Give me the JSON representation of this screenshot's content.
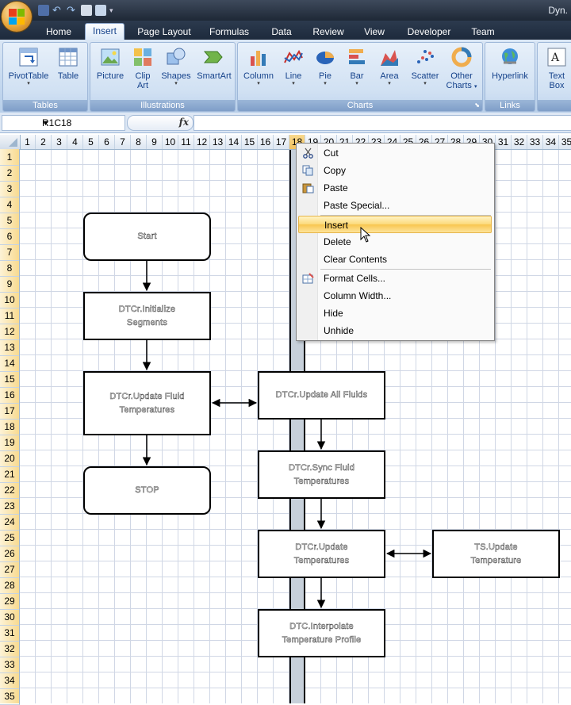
{
  "title_bar": {
    "app_title": "Dyn."
  },
  "tabs": [
    "Home",
    "Insert",
    "Page Layout",
    "Formulas",
    "Data",
    "Review",
    "View",
    "Developer",
    "Team"
  ],
  "active_tab": "Insert",
  "ribbon": {
    "groups": {
      "tables": {
        "label": "Tables",
        "buttons": [
          "PivotTable",
          "Table"
        ]
      },
      "illustrations": {
        "label": "Illustrations",
        "buttons": [
          "Picture",
          "Clip Art",
          "Shapes",
          "SmartArt"
        ]
      },
      "charts": {
        "label": "Charts",
        "buttons": [
          "Column",
          "Line",
          "Pie",
          "Bar",
          "Area",
          "Scatter",
          "Other Charts"
        ]
      },
      "links": {
        "label": "Links",
        "buttons": [
          "Hyperlink"
        ]
      },
      "text": {
        "buttons": [
          "Text Box"
        ]
      }
    },
    "clip_art_l1": "Clip",
    "clip_art_l2": "Art",
    "other_charts_l1": "Other",
    "other_charts_l2": "Charts",
    "text_box_l1": "Text",
    "text_box_l2": "Box"
  },
  "formula_bar": {
    "name_box": "R1C18",
    "fx_label": "fx",
    "formula": ""
  },
  "columns": [
    "1",
    "2",
    "3",
    "4",
    "5",
    "6",
    "7",
    "8",
    "9",
    "10",
    "11",
    "12",
    "13",
    "14",
    "15",
    "16",
    "17",
    "18",
    "19",
    "20",
    "21",
    "22",
    "23",
    "24",
    "25",
    "26",
    "27",
    "28",
    "29",
    "30",
    "31",
    "32",
    "33",
    "34",
    "35"
  ],
  "selected_column": "18",
  "rows": [
    "1",
    "2",
    "3",
    "4",
    "5",
    "6",
    "7",
    "8",
    "9",
    "10",
    "11",
    "12",
    "13",
    "14",
    "15",
    "16",
    "17",
    "18",
    "19",
    "20",
    "21",
    "22",
    "23",
    "24",
    "25",
    "26",
    "27",
    "28",
    "29",
    "30",
    "31",
    "32",
    "33",
    "34",
    "35"
  ],
  "flowchart": {
    "start": "Start",
    "initialize_l1": "DTCr.Initialize",
    "initialize_l2": "Segments",
    "update_fluid_l1": "DTCr.Update Fluid",
    "update_fluid_l2": "Temperatures",
    "stop": "STOP",
    "update_all": "DTCr.Update All Fluids",
    "sync_l1": "DTCr.Sync Fluid",
    "sync_l2": "Temperatures",
    "update_temp_l1": "DTCr.Update",
    "update_temp_l2": "Temperatures",
    "ts_update_l1": "TS.Update",
    "ts_update_l2": "Temperature",
    "profile_l1": "DTC.Interpolate",
    "profile_l2": "Temperature Profile"
  },
  "context_menu": {
    "items": [
      "Cut",
      "Copy",
      "Paste",
      "Paste Special...",
      "Insert",
      "Delete",
      "Clear Contents",
      "Format Cells...",
      "Column Width...",
      "Hide",
      "Unhide"
    ],
    "highlighted": "Insert"
  },
  "colors": {
    "accent": "#15428b",
    "highlight": "#f8c64f",
    "selected_header": "#f1c15f"
  }
}
